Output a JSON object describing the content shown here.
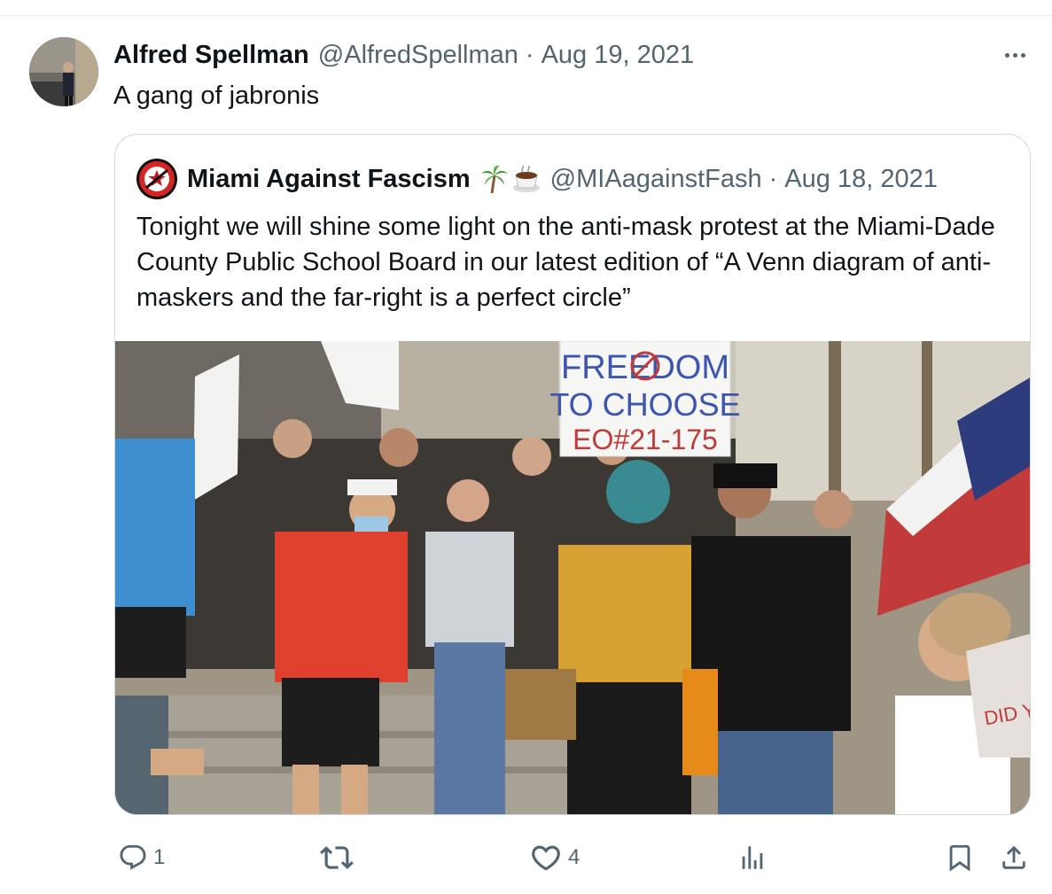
{
  "tweet": {
    "author_name": "Alfred Spellman",
    "handle": "@AlfredSpellman",
    "separator": "·",
    "date": "Aug 19, 2021",
    "text": "A gang of jabronis",
    "avatar_icon": "profile-photo"
  },
  "quote": {
    "author_name": "Miami Against Fascism",
    "emojis": [
      "palm-tree-emoji",
      "coffee-cup-emoji"
    ],
    "handle": "@MIAagainstFash",
    "separator": "·",
    "date": "Aug 18, 2021",
    "text": "Tonight we will shine some light on the anti-mask protest at the Miami-Dade County Public School Board in our latest edition of “A Venn diagram of anti-maskers and the far-right is a perfect circle”",
    "media": {
      "sign_text": [
        "FREEDOM",
        "TO CHOOSE",
        "EO#21-175"
      ],
      "side_sign_text": "DID YO"
    }
  },
  "actions": {
    "reply_count": "1",
    "retweet_count": "",
    "like_count": "4",
    "views_count": ""
  },
  "colors": {
    "text_primary": "#0f1419",
    "text_secondary": "#536471",
    "border": "#cfd9de"
  }
}
